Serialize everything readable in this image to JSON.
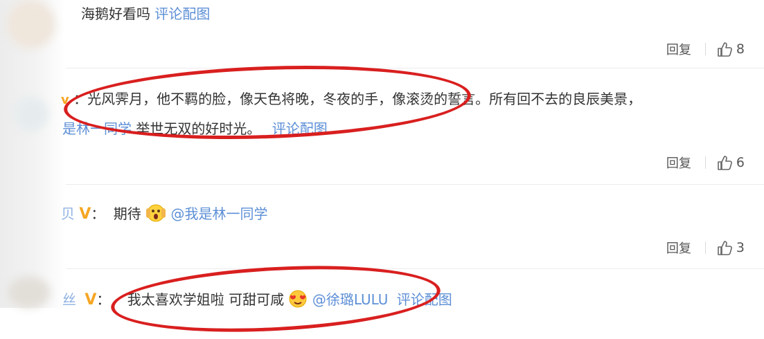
{
  "comments": [
    {
      "line1_text": "海鹅好看吗",
      "line1_link": "评论配图",
      "reply_label": "回复",
      "likes": "8"
    },
    {
      "username_fragment": "v",
      "line1_text": "：光风霁月，他不羁的脸，像天色将晚，冬夜的手，像滚烫的誓言。所有回不去的良辰美景，",
      "line2_mention": "是林一同学",
      "line2_text": "举世无双的好时光。",
      "line2_link": "评论配图",
      "reply_label": "回复",
      "likes": "6"
    },
    {
      "username_fragment": "贝",
      "vip_badge": "V",
      "colon": "：",
      "text": "期待",
      "emoji": "scream-emoji",
      "mention": "@我是林一同学",
      "reply_label": "回复",
      "likes": "3"
    },
    {
      "username_fragment": "丝",
      "vip_badge": "V",
      "colon": "：",
      "text": "我太喜欢学姐啦 可甜可咸",
      "emoji": "heart-eyes-emoji",
      "mention": "@徐璐LULU",
      "link": "评论配图"
    }
  ],
  "annotation_color": "#d91f1f",
  "link_color": "#5d8fd6",
  "vip_color": "#f5a623"
}
